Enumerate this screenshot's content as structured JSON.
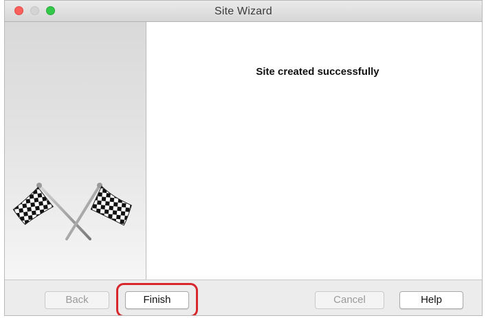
{
  "window": {
    "title": "Site Wizard"
  },
  "sidebar": {
    "image_icon": "checkered-flags-icon"
  },
  "main": {
    "message": "Site created successfully"
  },
  "footer": {
    "back_label": "Back",
    "finish_label": "Finish",
    "cancel_label": "Cancel",
    "help_label": "Help",
    "back_enabled": false,
    "cancel_enabled": false,
    "highlighted_button": "Finish"
  },
  "colors": {
    "close": "#fc605c",
    "minimize": "#d4d4d4",
    "maximize": "#34c84a",
    "highlight": "#d7262c"
  }
}
